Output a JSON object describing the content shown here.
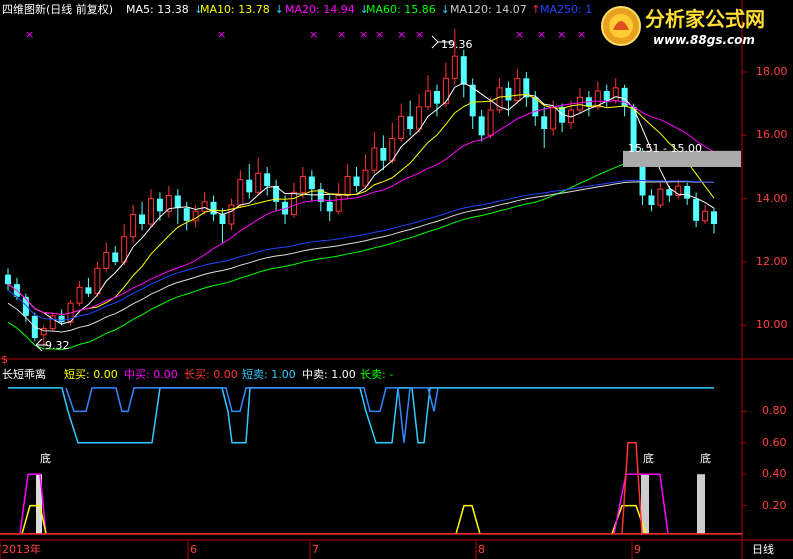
{
  "header": {
    "title": "四维图新(日线 前复权)",
    "ma": [
      {
        "label": "MA5: 13.38",
        "arrow": "↓",
        "color": "#ffffff"
      },
      {
        "label": "MA10: 13.78",
        "arrow": "↓",
        "color": "#ffff00"
      },
      {
        "label": "MA20: 14.94",
        "arrow": "↓",
        "color": "#ff00ff"
      },
      {
        "label": "MA60: 15.86",
        "arrow": "↓",
        "color": "#00ff00"
      },
      {
        "label": "MA120: 14.07",
        "arrow": "↑",
        "color": "#cccccc"
      },
      {
        "label": "MA250: 1",
        "arrow": "",
        "color": "#2244ff"
      }
    ]
  },
  "logo": {
    "name": "分析家公式网",
    "url": "www.88gs.com"
  },
  "price_axis": {
    "ticks": [
      "18.00",
      "16.00",
      "14.00",
      "12.00",
      "10.00"
    ],
    "values": [
      18,
      16,
      14,
      12,
      10
    ],
    "ylim": [
      9.0,
      19.8
    ]
  },
  "annotations": {
    "high": "19.36",
    "low": "9.32",
    "range_box": "15.51 - 15.00",
    "dollar": "$"
  },
  "indicator": {
    "name": "长短乖离",
    "items": [
      {
        "label": "短买: 0.00",
        "color": "#ffff00"
      },
      {
        "label": "中买: 0.00",
        "color": "#ff00ff"
      },
      {
        "label": "长买: 0.00",
        "color": "#ff3333"
      },
      {
        "label": "短卖: 1.00",
        "color": "#33ccff"
      },
      {
        "label": "中卖: 1.00",
        "color": "#ffffff"
      },
      {
        "label": "长卖: -",
        "color": "#00ff00"
      }
    ],
    "ticks": [
      "0.80",
      "0.60",
      "0.40",
      "0.20"
    ],
    "tick_values": [
      0.8,
      0.6,
      0.4,
      0.2
    ],
    "bottom_labels": [
      "底",
      "底",
      "底"
    ]
  },
  "time_axis": {
    "labels": [
      "2013年",
      "6",
      "7",
      "8",
      "9"
    ],
    "period": "日线"
  },
  "colors": {
    "up": "#ff3232",
    "down": "#54ffff",
    "axis": "#b00000"
  },
  "chart_data": {
    "type": "candlestick",
    "ylim": [
      9.0,
      19.8
    ],
    "series": [
      {
        "name": "MA5",
        "values": []
      },
      {
        "name": "MA10",
        "values": []
      },
      {
        "name": "MA20",
        "values": []
      },
      {
        "name": "MA60",
        "values": []
      },
      {
        "name": "MA120",
        "values": []
      },
      {
        "name": "MA250",
        "values": []
      }
    ],
    "candles": [
      [
        11.6,
        11.3,
        11.8,
        11.1
      ],
      [
        11.3,
        10.9,
        11.5,
        10.8
      ],
      [
        10.9,
        10.3,
        11.0,
        10.1
      ],
      [
        10.3,
        9.6,
        10.4,
        9.5
      ],
      [
        9.7,
        9.9,
        10.0,
        9.32
      ],
      [
        9.9,
        10.3,
        10.4,
        9.8
      ],
      [
        10.3,
        10.1,
        10.5,
        10.0
      ],
      [
        10.1,
        10.7,
        10.8,
        10.0
      ],
      [
        10.7,
        11.2,
        11.4,
        10.6
      ],
      [
        11.2,
        11.0,
        11.5,
        10.9
      ],
      [
        11.0,
        11.8,
        12.0,
        10.9
      ],
      [
        11.8,
        12.3,
        12.6,
        11.7
      ],
      [
        12.3,
        12.0,
        12.5,
        11.9
      ],
      [
        12.0,
        12.8,
        13.2,
        11.9
      ],
      [
        12.8,
        13.5,
        13.8,
        12.6
      ],
      [
        13.5,
        13.2,
        13.9,
        13.0
      ],
      [
        13.2,
        14.0,
        14.3,
        13.1
      ],
      [
        14.0,
        13.6,
        14.2,
        13.3
      ],
      [
        13.6,
        14.1,
        14.4,
        13.4
      ],
      [
        14.1,
        13.7,
        14.3,
        13.2
      ],
      [
        13.7,
        13.3,
        13.9,
        13.0
      ],
      [
        13.3,
        13.6,
        13.8,
        13.1
      ],
      [
        13.6,
        13.9,
        14.2,
        13.5
      ],
      [
        13.9,
        13.5,
        14.1,
        13.3
      ],
      [
        13.5,
        13.2,
        13.7,
        12.6
      ],
      [
        13.2,
        13.8,
        14.0,
        13.0
      ],
      [
        13.8,
        14.6,
        14.9,
        13.7
      ],
      [
        14.6,
        14.2,
        15.1,
        14.0
      ],
      [
        14.2,
        14.8,
        15.3,
        14.1
      ],
      [
        14.8,
        14.4,
        15.0,
        14.1
      ],
      [
        14.4,
        13.9,
        14.6,
        13.6
      ],
      [
        13.9,
        13.5,
        14.1,
        13.2
      ],
      [
        13.5,
        14.2,
        14.5,
        13.4
      ],
      [
        14.2,
        14.7,
        15.0,
        14.0
      ],
      [
        14.7,
        14.3,
        14.9,
        13.9
      ],
      [
        14.3,
        13.9,
        14.5,
        13.6
      ],
      [
        13.9,
        13.6,
        14.1,
        13.3
      ],
      [
        13.6,
        14.1,
        14.5,
        13.5
      ],
      [
        14.1,
        14.7,
        15.1,
        14.0
      ],
      [
        14.7,
        14.4,
        15.0,
        14.2
      ],
      [
        14.4,
        14.9,
        15.4,
        14.3
      ],
      [
        14.9,
        15.6,
        16.1,
        14.8
      ],
      [
        15.6,
        15.2,
        16.0,
        14.9
      ],
      [
        15.2,
        15.9,
        16.4,
        15.1
      ],
      [
        15.9,
        16.6,
        17.0,
        15.8
      ],
      [
        16.6,
        16.2,
        17.1,
        16.0
      ],
      [
        16.2,
        16.9,
        17.3,
        16.1
      ],
      [
        16.9,
        17.4,
        17.9,
        16.8
      ],
      [
        17.4,
        17.0,
        17.6,
        16.6
      ],
      [
        17.0,
        17.8,
        18.3,
        16.9
      ],
      [
        17.8,
        18.5,
        19.36,
        17.6
      ],
      [
        18.5,
        17.6,
        18.7,
        17.2
      ],
      [
        17.6,
        16.6,
        17.8,
        16.2
      ],
      [
        16.6,
        16.0,
        16.8,
        15.8
      ],
      [
        16.0,
        16.8,
        17.2,
        15.9
      ],
      [
        16.8,
        17.5,
        17.8,
        16.7
      ],
      [
        17.5,
        17.1,
        17.7,
        16.6
      ],
      [
        17.1,
        17.8,
        18.1,
        17.0
      ],
      [
        17.8,
        17.2,
        18.0,
        16.9
      ],
      [
        17.2,
        16.6,
        17.4,
        16.3
      ],
      [
        16.6,
        16.2,
        16.9,
        15.6
      ],
      [
        16.2,
        16.9,
        17.1,
        16.0
      ],
      [
        16.9,
        16.4,
        17.0,
        16.1
      ],
      [
        16.4,
        16.8,
        17.1,
        16.2
      ],
      [
        16.8,
        17.2,
        17.5,
        16.7
      ],
      [
        17.2,
        16.9,
        17.4,
        16.6
      ],
      [
        16.9,
        17.4,
        17.7,
        16.8
      ],
      [
        17.4,
        17.1,
        17.6,
        16.9
      ],
      [
        17.1,
        17.5,
        17.8,
        17.0
      ],
      [
        17.5,
        16.9,
        17.6,
        16.6
      ],
      [
        16.9,
        15.4,
        17.0,
        15.2
      ],
      [
        15.4,
        14.1,
        15.6,
        13.8
      ],
      [
        14.1,
        13.8,
        14.3,
        13.6
      ],
      [
        13.8,
        14.3,
        14.5,
        13.7
      ],
      [
        14.3,
        14.1,
        14.4,
        13.9
      ],
      [
        14.1,
        14.4,
        14.6,
        14.0
      ],
      [
        14.4,
        14.0,
        14.5,
        13.8
      ],
      [
        14.0,
        13.3,
        14.2,
        13.1
      ],
      [
        13.3,
        13.6,
        13.8,
        13.2
      ],
      [
        13.6,
        13.2,
        13.7,
        12.9
      ]
    ]
  }
}
